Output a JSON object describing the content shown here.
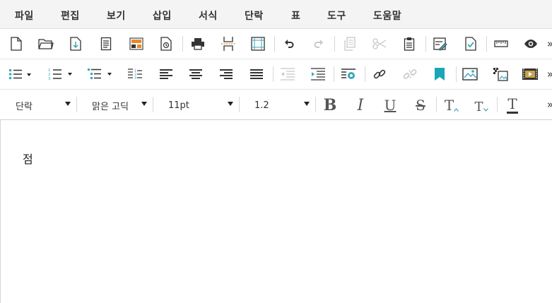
{
  "menu": [
    {
      "label": "파일"
    },
    {
      "label": "편집"
    },
    {
      "label": "보기"
    },
    {
      "label": "삽입"
    },
    {
      "label": "서식"
    },
    {
      "label": "단락"
    },
    {
      "label": "표"
    },
    {
      "label": "도구"
    },
    {
      "label": "도움말"
    }
  ],
  "toolbar1": {
    "icons": [
      "new-document",
      "open-folder",
      "save-download",
      "document-page",
      "template",
      "history-document",
      "print",
      "page-break",
      "page-border",
      "undo",
      "redo",
      "copy",
      "cut",
      "paste",
      "edit-image",
      "check-document",
      "ruler",
      "preview-eye"
    ],
    "more": "»"
  },
  "toolbar2": {
    "icons": [
      "bullet-list",
      "numbered-list",
      "multilevel-list",
      "line-numbering",
      "align-left",
      "align-center",
      "align-right",
      "align-justify",
      "decrease-indent",
      "increase-indent",
      "settings-box",
      "insert-link",
      "remove-link",
      "bookmark",
      "insert-image",
      "mosaic-image",
      "insert-video"
    ],
    "more": "»"
  },
  "toolbar3": {
    "paragraph_style": "단락",
    "font_family": "맑은 고딕",
    "font_size": "11pt",
    "line_height": "1.2",
    "bold": "B",
    "italic": "I",
    "underline": "U",
    "strikethrough": "S",
    "superscript": "T",
    "subscript": "T",
    "text_color": "T",
    "more": "»"
  },
  "colors": {
    "accent_teal": "#3aa6b9",
    "bookmark_teal": "#1ba6b8",
    "icon_dark": "#333333",
    "icon_disabled": "#c8c8c8",
    "template_orange": "#e68a2e"
  },
  "editor": {
    "content": "점"
  }
}
